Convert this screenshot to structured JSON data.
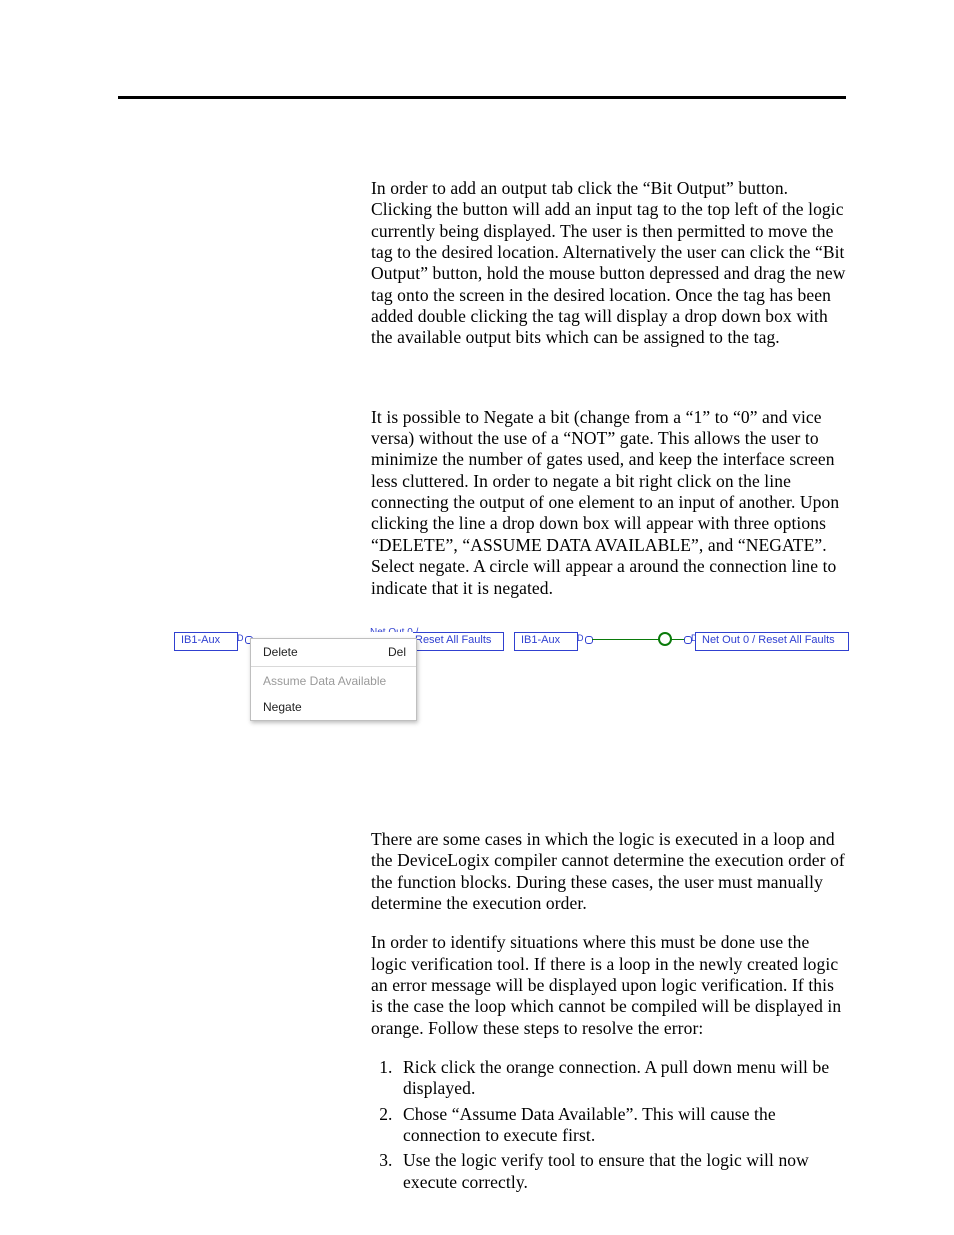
{
  "para1": "In order to add an output tab click the “Bit  Output” button.   Clicking the button will add an input tag to the top left of the logic currently being displayed.  The user is then permitted to move the tag to the desired location.  Alternatively  the user can click the “Bit  Output” button, hold the mouse button depressed and drag the new tag onto the screen in the desired location.   Once the tag has been added double clicking the tag will display a drop down box with the available  output bits which can be assigned to the tag.",
  "para2": "It is possible to Negate a bit (change from a “1” to “0” and vice versa) without the use of a “NOT” gate.   This allows the user to minimize  the number of gates used, and keep the interface screen less cluttered.  In order to negate a bit right click on the line connecting the output of one element to an input of another.  Upon clicking the line  a drop down box will appear with three options “DELETE”, “ASSUME DATA AVAILABLE”,   and “NEGATE”.  Select negate.   A circle will appear a around the connection line to indicate that it is negated.",
  "para3": "There are some cases in which the logic is executed in a loop and the DeviceLogix compiler cannot determine the execution order of the function blocks.  During these cases, the user must manually determine the execution order.",
  "para4": "In order to identify situations where this must be done use the logic verification tool.    If there is a loop in the newly created logic an error message will be displayed  upon logic verification.   If this is the case the loop which cannot be compiled will be displayed in orange.  Follow these steps to resolve the error:",
  "steps": [
    "Rick click  the orange connection.  A pull down menu will be displayed.",
    "Chose “Assume Data Available”.   This will cause the connection to execute first.",
    "Use the logic verify tool to ensure that the logic will now execute correctly."
  ],
  "diagram": {
    "left": {
      "src_label": "IB1-Aux",
      "dst_label": "Reset All Faults",
      "dst_partial_above": "Net Out 0 /",
      "menu": {
        "delete": "Delete",
        "delete_accel": "Del",
        "assume": "Assume Data Available",
        "negate": "Negate"
      }
    },
    "right": {
      "src_label": "IB1-Aux",
      "dst_label": "Net Out 0 / Reset All Faults"
    }
  }
}
